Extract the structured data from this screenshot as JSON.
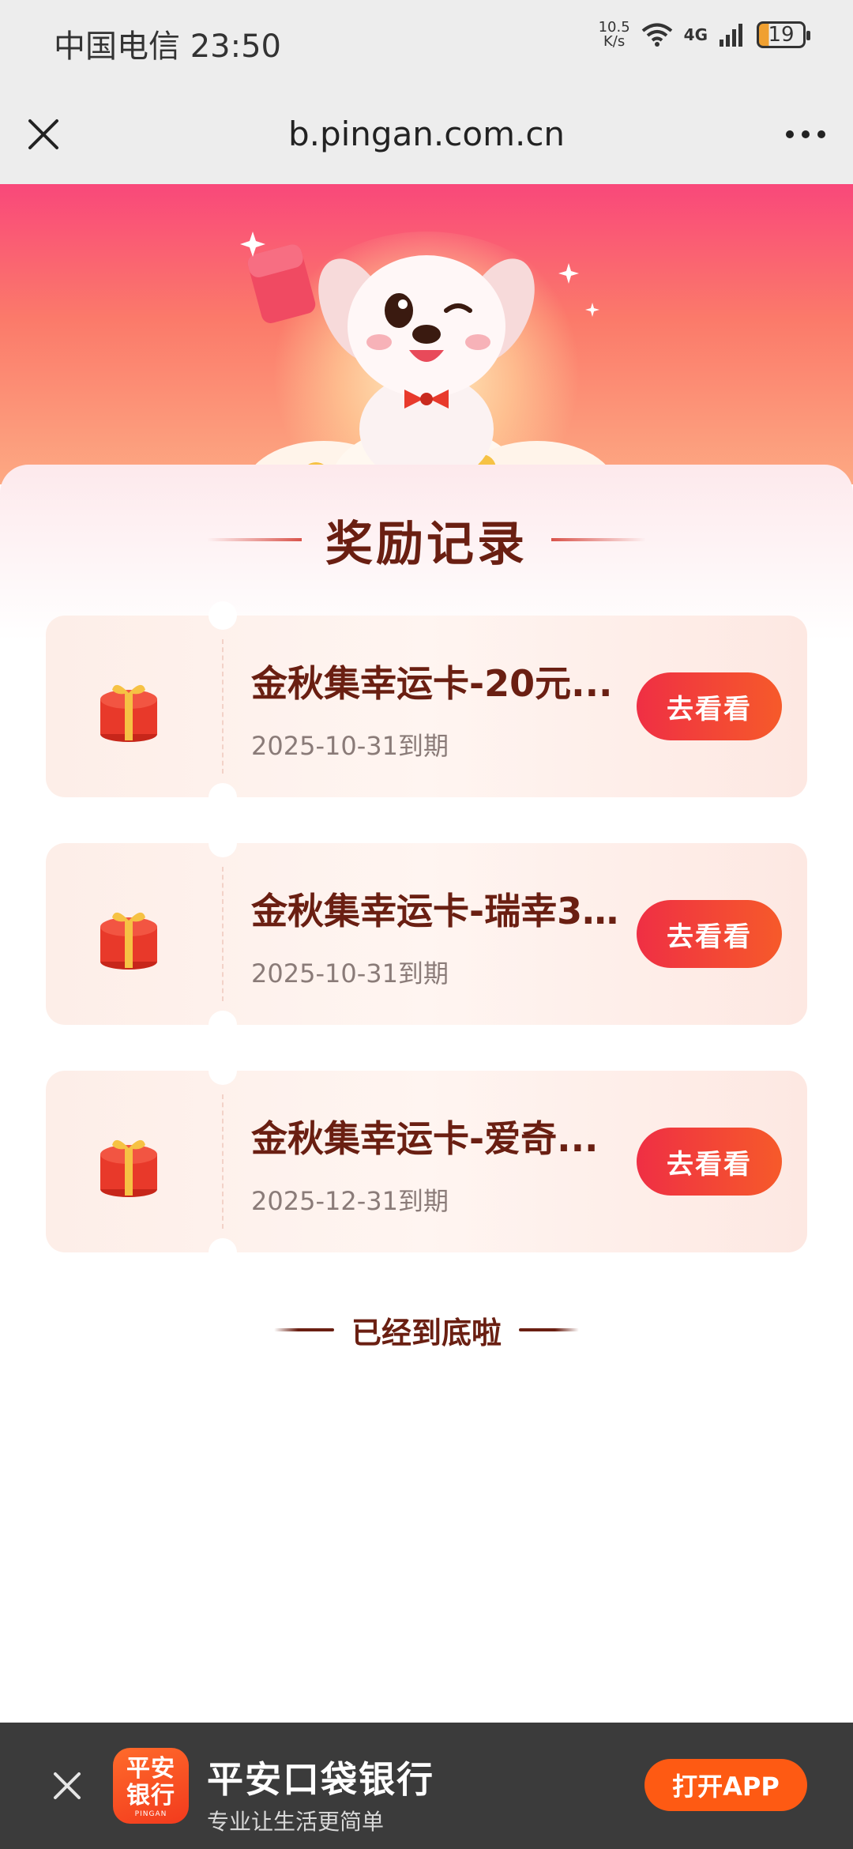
{
  "status_bar": {
    "carrier_time": "中国电信 23:50",
    "net_speed_value": "10.5",
    "net_speed_unit": "K/s",
    "network_type": "4G",
    "battery": "19"
  },
  "browser": {
    "url": "b.pingan.com.cn"
  },
  "page": {
    "title": "奖励记录",
    "end_text": "已经到底啦"
  },
  "rewards": [
    {
      "name": "金秋集幸运卡-20元...",
      "expiry": "2025-10-31到期",
      "button": "去看看"
    },
    {
      "name": "金秋集幸运卡-瑞幸3...",
      "expiry": "2025-10-31到期",
      "button": "去看看"
    },
    {
      "name": "金秋集幸运卡-爱奇...",
      "expiry": "2025-12-31到期",
      "button": "去看看"
    }
  ],
  "app_banner": {
    "logo_line1": "平安",
    "logo_line2": "银行",
    "logo_small": "PINGAN",
    "name": "平安口袋银行",
    "slogan": "专业让生活更简单",
    "open_button": "打开APP"
  },
  "colors": {
    "accent": "#ef2f44",
    "title_brown": "#6a1f12",
    "banner_orange": "#fe5a13"
  }
}
